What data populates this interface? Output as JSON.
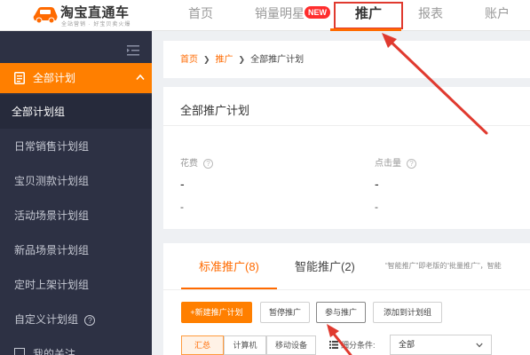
{
  "header": {
    "brand_name": "淘宝直通车",
    "brand_tagline": "全站营销 · 好宝贝卖火爆",
    "nav": {
      "home": "首页",
      "best_sellers": "销量明星",
      "new_badge": "NEW",
      "promotion": "推广",
      "reports": "报表",
      "account": "账户"
    }
  },
  "sidebar": {
    "section_title": "全部计划",
    "items": [
      {
        "label": "全部计划组"
      },
      {
        "label": "日常销售计划组"
      },
      {
        "label": "宝贝测款计划组"
      },
      {
        "label": "活动场景计划组"
      },
      {
        "label": "新品场景计划组"
      },
      {
        "label": "定时上架计划组"
      },
      {
        "label": "自定义计划组"
      },
      {
        "label": "我的关注"
      }
    ],
    "help_glyph": "?"
  },
  "breadcrumb": {
    "home": "首页",
    "promotion": "推广",
    "current": "全部推广计划",
    "sep": "❯"
  },
  "overview": {
    "title": "全部推广计划",
    "metrics": [
      {
        "label": "花费",
        "value": "-",
        "sub": "-"
      },
      {
        "label": "点击量",
        "value": "-",
        "sub": "-"
      }
    ],
    "help_glyph": "?"
  },
  "plans": {
    "tabs": {
      "standard": "标准推广(8)",
      "smart": "智能推广(2)"
    },
    "note": "“智能推广”即老版的“批量推广”，智能",
    "buttons": {
      "new_plan": "+新建推广计划",
      "pause": "暂停推广",
      "join": "参与推广",
      "add_to_group": "添加到计划组"
    },
    "device_filter": {
      "summary": "汇总",
      "pc": "计算机",
      "mobile": "移动设备"
    },
    "filter_label": "细分条件:",
    "select_value": "全部"
  },
  "colors": {
    "accent": "#ff7f00",
    "sidebar_bg": "#2d3144",
    "annotation_red": "#e03a2f",
    "badge_red": "#ff2d2d"
  }
}
